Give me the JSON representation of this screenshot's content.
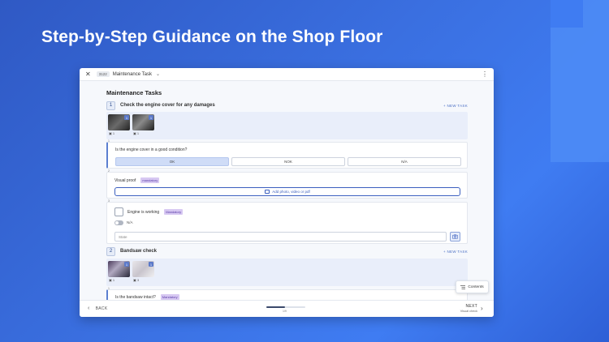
{
  "headline": "Step-by-Step Guidance on the Shop Floor",
  "window": {
    "code": "3122",
    "title": "Maintenance Task",
    "close_glyph": "✕",
    "chevron_glyph": "⌄",
    "kebab_glyph": "⋮"
  },
  "section_title": "Maintenance Tasks",
  "new_task_label": "+ NEW TASK",
  "tasks": [
    {
      "number": "1",
      "title": "Check the engine cover for any damages",
      "thumbs": [
        {
          "count": "1",
          "badge": "1"
        },
        {
          "count": "1",
          "badge": "1"
        }
      ]
    },
    {
      "number": "2",
      "title": "Bandsaw check",
      "thumbs": [
        {
          "count": "1",
          "badge": "1"
        },
        {
          "count": "3",
          "badge": "1"
        }
      ]
    }
  ],
  "question1": {
    "text": "Is the engine cover in a good condition?",
    "options": [
      "OK",
      "NOK",
      "N/A"
    ],
    "selected": "OK",
    "index": "2"
  },
  "visual_proof": {
    "label": "Visual proof",
    "tag": "mandatory",
    "button": "Add photo, video or pdf",
    "index": "3"
  },
  "engine_check": {
    "label": "Engine is working",
    "tag": "Mandatory",
    "na_label": "N/A",
    "state_placeholder": "State",
    "index": "4"
  },
  "question2": {
    "text": "Is the bandsaw intact?",
    "tag": "Mandatory"
  },
  "contents_label": "Contents",
  "footer": {
    "back": "BACK",
    "progress_text": "1/9",
    "progress_fraction": 0.48,
    "next": "NEXT",
    "next_sub": "Visual check"
  },
  "colors": {
    "accent": "#3b5fbf",
    "tag_bg": "#d7c8f2",
    "selected_bg": "#cfdcf7"
  }
}
